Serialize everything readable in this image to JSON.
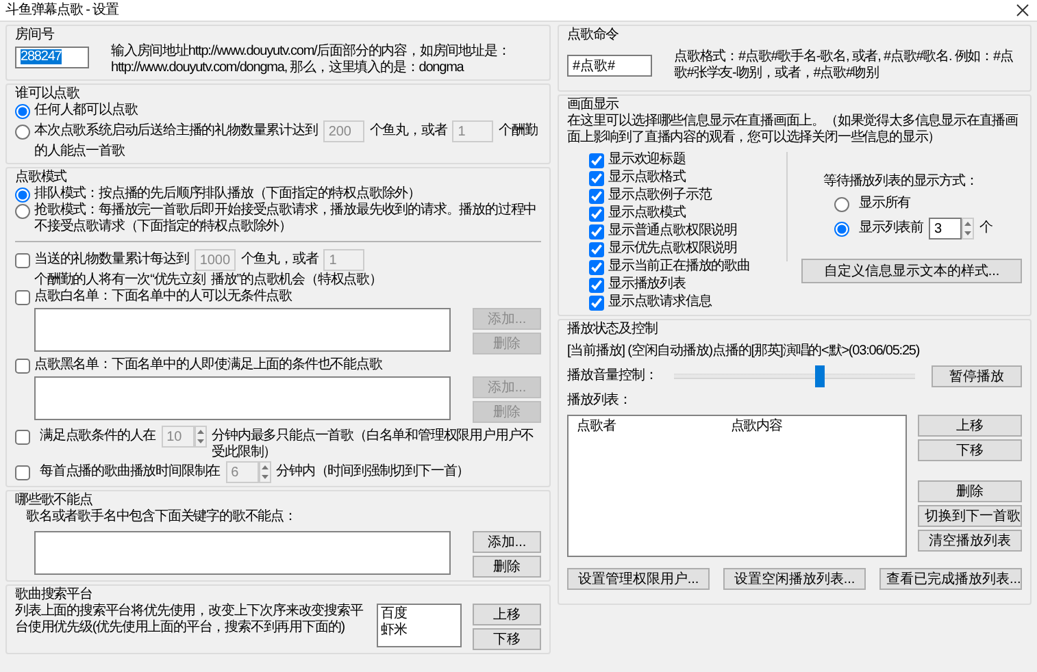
{
  "window": {
    "title": "斗鱼弹幕点歌 - 设置"
  },
  "room": {
    "title": "房间号",
    "field": {
      "value": "288247",
      "text_selected": true
    },
    "hint": "输入房间地址http://www.douyutv.com/后面部分的内容，如房间地址是：http://www.douyutv.com/dongma, 那么，这里填入的是：dongma"
  },
  "who_can": {
    "title": "谁可以点歌",
    "options": [
      {
        "kind": "plain",
        "label": "任何人都可以点歌",
        "selected": true
      },
      {
        "kind": "threshold",
        "lines": [
          [
            {
              "kind": "text",
              "text": "本次点歌系统启动后送给主播的礼物数量累计达到"
            },
            {
              "kind": "field",
              "value": "200",
              "disabled": true
            },
            {
              "kind": "text",
              "text": "个鱼丸，或者"
            },
            {
              "kind": "field",
              "value": "1",
              "disabled": true
            },
            {
              "kind": "text",
              "text": "个酬勤"
            }
          ],
          [
            {
              "kind": "text",
              "text": "的人能点一首歌"
            }
          ]
        ],
        "selected": false
      }
    ]
  },
  "mode": {
    "title": "点歌模式",
    "options": [
      {
        "label": "排队模式：按点播的先后顺序排队播放（下面指定的特权点歌除外）",
        "selected": true
      },
      {
        "label": "抢歌模式：每播放完一首歌后即开始接受点歌请求，播放最先收到的请求。播放的过程中不接受点歌请求（下面指定的特权点歌除外）",
        "selected": false
      }
    ],
    "privilege": {
      "checked": false,
      "lines": [
        [
          {
            "kind": "text",
            "text": "当送的礼物数量累计每达到"
          },
          {
            "kind": "field",
            "value": "1000",
            "disabled": true
          },
          {
            "kind": "text",
            "text": "个鱼丸，或者"
          },
          {
            "kind": "field",
            "value": "1",
            "disabled": true
          }
        ],
        [
          {
            "kind": "text",
            "text": "个酬勤的人将有一次“优先立刻"
          },
          {
            "kind": "text",
            "text": "播放”的点歌机会（特权点歌）"
          }
        ]
      ]
    },
    "lists": [
      {
        "label": "点歌白名单：下面名单中的人可以无条件点歌",
        "checked": false,
        "buttons": [
          {
            "label": "添加...",
            "disabled": true
          },
          {
            "label": "删除",
            "disabled": true
          }
        ]
      },
      {
        "label": "点歌黑名单：下面名单中的人即使满足上面的条件也不能点歌",
        "checked": false,
        "buttons": [
          {
            "label": "添加...",
            "disabled": true
          },
          {
            "label": "删除",
            "disabled": true
          }
        ]
      }
    ],
    "limits": [
      {
        "checked": false,
        "before": "满足点歌条件的人在",
        "field": {
          "value": "10",
          "disabled": true
        },
        "after": "分钟内最多只能点一首歌（白名单和管理权限用户用户不受此限制）"
      },
      {
        "checked": false,
        "before": "每首点播的歌曲播放时间限制在",
        "field": {
          "value": "6",
          "disabled": true
        },
        "after": "分钟内（时间到强制切到下一首）"
      }
    ]
  },
  "banned": {
    "title": "哪些歌不能点",
    "label": "歌名或者歌手名中包含下面关键字的歌不能点：",
    "buttons": [
      {
        "label": "添加...",
        "disabled": false
      },
      {
        "label": "删除",
        "disabled": false
      }
    ]
  },
  "search": {
    "title": "歌曲搜索平台",
    "text": "列表上面的搜索平台将优先使用，改变上下次序来改变搜索平台使用优先级(优先使用上面的平台，搜索不到再用下面的)",
    "platforms": [
      "百度",
      "虾米"
    ],
    "buttons": [
      "上移",
      "下移"
    ]
  },
  "command": {
    "title": "点歌命令",
    "field": {
      "value": "#点歌#"
    },
    "hint": "点歌格式：#点歌#歌手名-歌名, 或者, #点歌#歌名. 例如：#点歌#张学友-吻别，或者，#点歌#吻别"
  },
  "display": {
    "title": "画面显示",
    "description": "在这里可以选择哪些信息显示在直播画面上。（如果觉得太多信息显示在直播画面上影响到了直播内容的观看，您可以选择关闭一些信息的显示）",
    "options": [
      {
        "label": "显示欢迎标题",
        "checked": true
      },
      {
        "label": "显示点歌格式",
        "checked": true
      },
      {
        "label": "显示点歌例子示范",
        "checked": true
      },
      {
        "label": "显示点歌模式",
        "checked": true
      },
      {
        "label": "显示普通点歌权限说明",
        "checked": true
      },
      {
        "label": "显示优先点歌权限说明",
        "checked": true
      },
      {
        "label": "显示当前正在播放的歌曲",
        "checked": true
      },
      {
        "label": "显示播放列表",
        "checked": true
      },
      {
        "label": "显示点歌请求信息",
        "checked": true
      }
    ],
    "list_mode": {
      "label": "等待播放列表的显示方式：",
      "options": [
        {
          "label": "显示所有",
          "selected": false
        },
        {
          "label": "显示列表前",
          "selected": true
        }
      ],
      "count": "3",
      "unit": "个"
    },
    "style_button": "自定义信息显示文本的样式..."
  },
  "playback": {
    "title": "播放状态及控制",
    "now_playing": "[当前播放] (空闲自动播放)点播的[那英]演唱的<默>(03:06/05:25)",
    "volume_label": "播放音量控制：",
    "volume": {
      "level": 0.6
    },
    "pause_button": "暂停播放",
    "playlist_label": "播放列表：",
    "columns": [
      "点歌者",
      "点歌内容"
    ],
    "order_buttons": [
      "上移",
      "下移"
    ],
    "action_buttons": [
      "删除",
      "切换到下一首歌",
      "清空播放列表"
    ],
    "bottom_buttons": [
      "设置管理权限用户...",
      "设置空闲播放列表...",
      "查看已完成播放列表..."
    ]
  }
}
